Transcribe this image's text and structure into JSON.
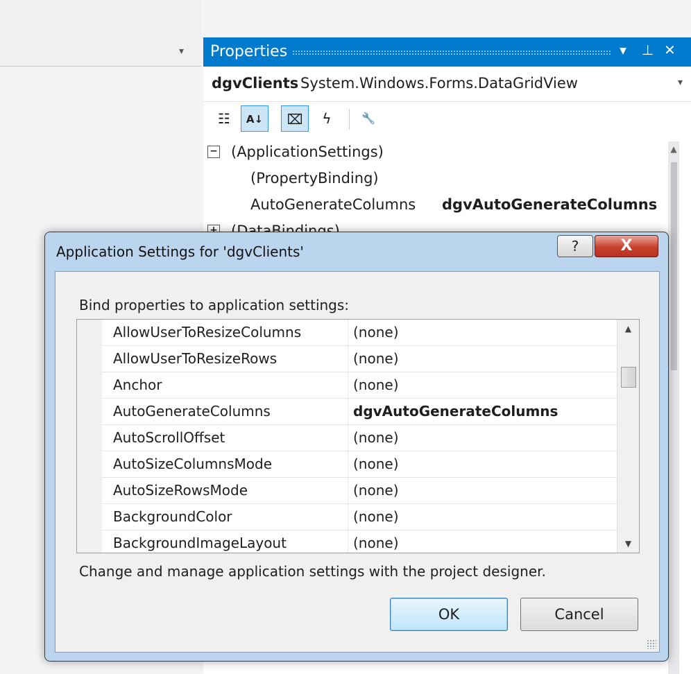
{
  "editor": {
    "dropdown_icon": "▾"
  },
  "properties_panel": {
    "title": "Properties",
    "controls": {
      "dropdown": "▾",
      "pin": "⊥",
      "close": "✕"
    },
    "object": {
      "name": "dgvClients",
      "type": "System.Windows.Forms.DataGridView",
      "dropdown": "▾"
    },
    "toolbar": {
      "categorized": "☷",
      "alphabetical": "A↓",
      "properties": "⌧",
      "events": "ϟ",
      "property_pages": "🔧"
    },
    "rows": [
      {
        "toggle": "−",
        "name": "(ApplicationSettings)",
        "value": ""
      },
      {
        "toggle": "",
        "name": "(PropertyBinding)",
        "value": ""
      },
      {
        "toggle": "",
        "name": "AutoGenerateColumns",
        "value": "dgvAutoGenerateColumns"
      },
      {
        "toggle": "+",
        "name": "(DataBindings)",
        "value": ""
      }
    ],
    "scroll_up": "▲"
  },
  "dialog": {
    "title": "Application Settings for 'dgvClients'",
    "help_label": "?",
    "close_label": "X",
    "bind_label": "Bind properties to application settings:",
    "rows": [
      {
        "name": "AllowUserToResizeColumns",
        "value": "(none)"
      },
      {
        "name": "AllowUserToResizeRows",
        "value": "(none)"
      },
      {
        "name": "Anchor",
        "value": "(none)"
      },
      {
        "name": "AutoGenerateColumns",
        "value": "dgvAutoGenerateColumns"
      },
      {
        "name": "AutoScrollOffset",
        "value": "(none)"
      },
      {
        "name": "AutoSizeColumnsMode",
        "value": "(none)"
      },
      {
        "name": "AutoSizeRowsMode",
        "value": "(none)"
      },
      {
        "name": "BackgroundColor",
        "value": "(none)"
      },
      {
        "name": "BackgroundImageLayout",
        "value": "(none)"
      }
    ],
    "scroll_up": "▲",
    "scroll_down": "▼",
    "manage_text": "Change and manage application settings with the project designer.",
    "ok_label": "OK",
    "cancel_label": "Cancel"
  }
}
